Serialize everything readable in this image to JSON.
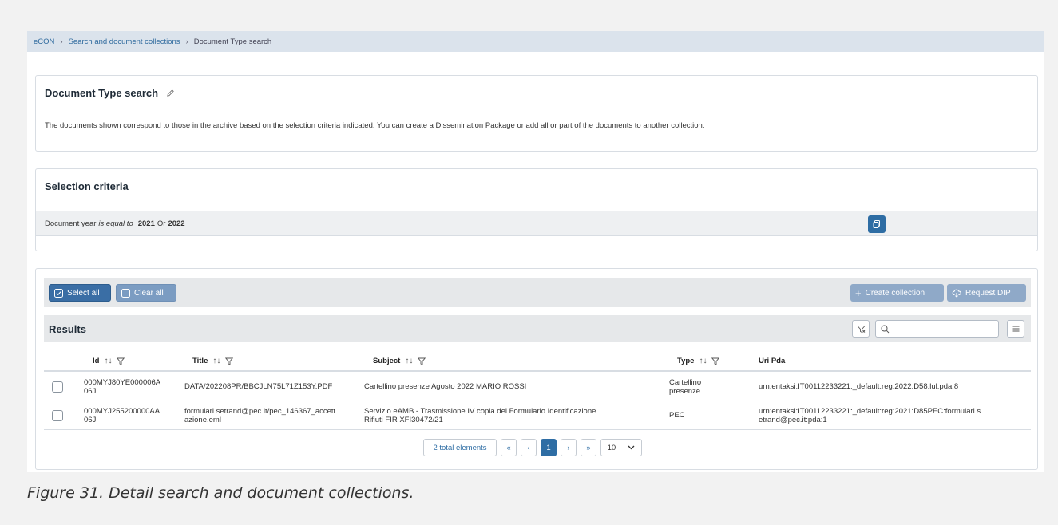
{
  "breadcrumb": {
    "root": "eCON",
    "separator": "›",
    "level1": "Search and document collections",
    "level2": "Document Type search"
  },
  "info_card": {
    "title": "Document Type search",
    "description": "The documents shown correspond to those in the archive based on the selection criteria indicated. You can create a Dissemination Package or add all or part of the documents to another collection."
  },
  "criteria_card": {
    "title": "Selection criteria",
    "field": "Document year",
    "operator": "is equal to",
    "value1": "2021",
    "connector": "Or",
    "value2": "2022"
  },
  "toolbar": {
    "select_all": "Select all",
    "clear_all": "Clear all",
    "create_collection": "Create collection",
    "request_dip": "Request DIP"
  },
  "results": {
    "title": "Results",
    "search_placeholder": "",
    "sort_glyph": "↑↓",
    "columns": {
      "id": "Id",
      "title": "Title",
      "subject": "Subject",
      "type": "Type",
      "uri": "Uri Pda"
    },
    "rows": [
      {
        "id1": "000MYJ80YE000006A",
        "id2": "06J",
        "title1": "DATA/202208PR/BBCJLN75L71Z153Y.PDF",
        "title2": "",
        "subject1": "Cartellino presenze Agosto 2022 MARIO ROSSI",
        "subject2": "",
        "type1": "Cartellino",
        "type2": "presenze",
        "uri1": "urn:entaksi:IT00112233221:_default:reg:2022:D58:lul:pda:8",
        "uri2": ""
      },
      {
        "id1": "000MYJ255200000AA",
        "id2": "06J",
        "title1": "formulari.setrand@pec.it/pec_146367_accett",
        "title2": "azione.eml",
        "subject1": "Servizio eAMB - Trasmissione IV copia del Formulario Identificazione",
        "subject2": "Rifiuti FIR XFI30472/21",
        "type1": "PEC",
        "type2": "",
        "uri1": "urn:entaksi:IT00112233221:_default:reg:2021:D85PEC:formulari.s",
        "uri2": "etrand@pec.it:pda:1"
      }
    ]
  },
  "pagination": {
    "total": "2 total elements",
    "first": "«",
    "prev": "‹",
    "current": "1",
    "next": "›",
    "last": "»",
    "page_size": "10"
  },
  "caption": "Figure 31. Detail search and document collections.",
  "colors": {
    "primary": "#2e6da4",
    "breadcrumb_bg": "#dbe3ec",
    "toolbar_bg": "#e6e8ea"
  }
}
